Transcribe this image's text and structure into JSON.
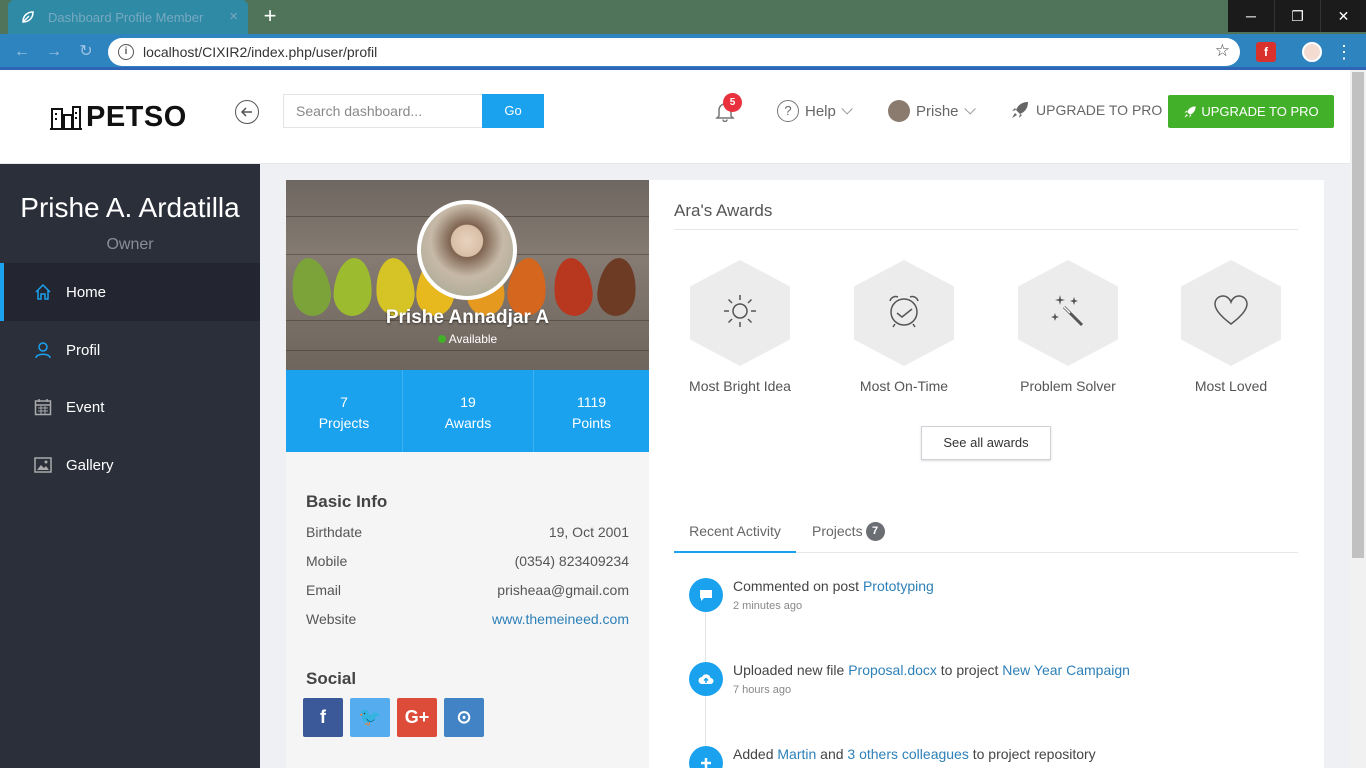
{
  "browser": {
    "tab_title": "Dashboard Profile Member",
    "tab_close": "×",
    "new_tab": "+",
    "url": "localhost/CIXIR2/index.php/user/profil",
    "window_minimize": "─",
    "window_restore": "❐",
    "window_close": "✕"
  },
  "header": {
    "logo_text": "PETSO",
    "search_placeholder": "Search dashboard...",
    "go_label": "Go",
    "notification_count": "5",
    "help_label": "Help",
    "user_label": "Prishe",
    "upgrade_link_label": "UPGRADE TO PRO",
    "upgrade_button_label": "UPGRADE TO PRO"
  },
  "sidebar": {
    "name": "Prishe A. Ardatilla",
    "role": "Owner",
    "items": [
      {
        "label": "Home",
        "icon": "home-icon"
      },
      {
        "label": "Profil",
        "icon": "user-icon"
      },
      {
        "label": "Event",
        "icon": "calendar-icon"
      },
      {
        "label": "Gallery",
        "icon": "image-icon"
      }
    ]
  },
  "profile": {
    "name": "Prishe Annadjar A",
    "status": "Available",
    "stats": [
      {
        "value": "7",
        "label": "Projects"
      },
      {
        "value": "19",
        "label": "Awards"
      },
      {
        "value": "1119",
        "label": "Points"
      }
    ],
    "basic_info_title": "Basic Info",
    "basic_info": [
      {
        "label": "Birthdate",
        "value": "19, Oct 2001"
      },
      {
        "label": "Mobile",
        "value": "(0354) 823409234"
      },
      {
        "label": "Email",
        "value": "prisheaa@gmail.com"
      },
      {
        "label": "Website",
        "value": "www.themeineed.com"
      }
    ],
    "social_title": "Social",
    "social": [
      {
        "label": "f",
        "color": "#3b5998"
      },
      {
        "label": "🐦",
        "color": "#55acee"
      },
      {
        "label": "G+",
        "color": "#dd4b39"
      },
      {
        "label": "⊙",
        "color": "#4183c4"
      }
    ]
  },
  "awards": {
    "title": "Ara's Awards",
    "items": [
      {
        "label": "Most Bright Idea",
        "icon": "sun-icon"
      },
      {
        "label": "Most On-Time",
        "icon": "alarm-clock-icon"
      },
      {
        "label": "Problem Solver",
        "icon": "magic-wand-icon"
      },
      {
        "label": "Most Loved",
        "icon": "heart-icon"
      }
    ],
    "see_all_label": "See all awards"
  },
  "activity": {
    "tabs": [
      {
        "label": "Recent Activity"
      },
      {
        "label": "Projects",
        "badge": "7"
      }
    ],
    "items": [
      {
        "prefix": "Commented on post ",
        "link": "Prototyping",
        "time": "2 minutes ago",
        "icon": "comment-icon"
      },
      {
        "prefix": "Uploaded new file ",
        "link": "Proposal.docx",
        "middle": " to project ",
        "link2": "New Year Campaign",
        "time": "7 hours ago",
        "icon": "cloud-upload-icon"
      },
      {
        "prefix": "Added ",
        "link": "Martin",
        "middle": " and ",
        "link2": "3 others colleagues",
        "suffix": " to project repository",
        "icon": "plus-icon"
      }
    ]
  },
  "colors": {
    "accent": "#1aa2ef",
    "sidebar_bg": "#2b2f3a",
    "upgrade_green": "#43b02a",
    "badge_red": "#e8313c"
  }
}
